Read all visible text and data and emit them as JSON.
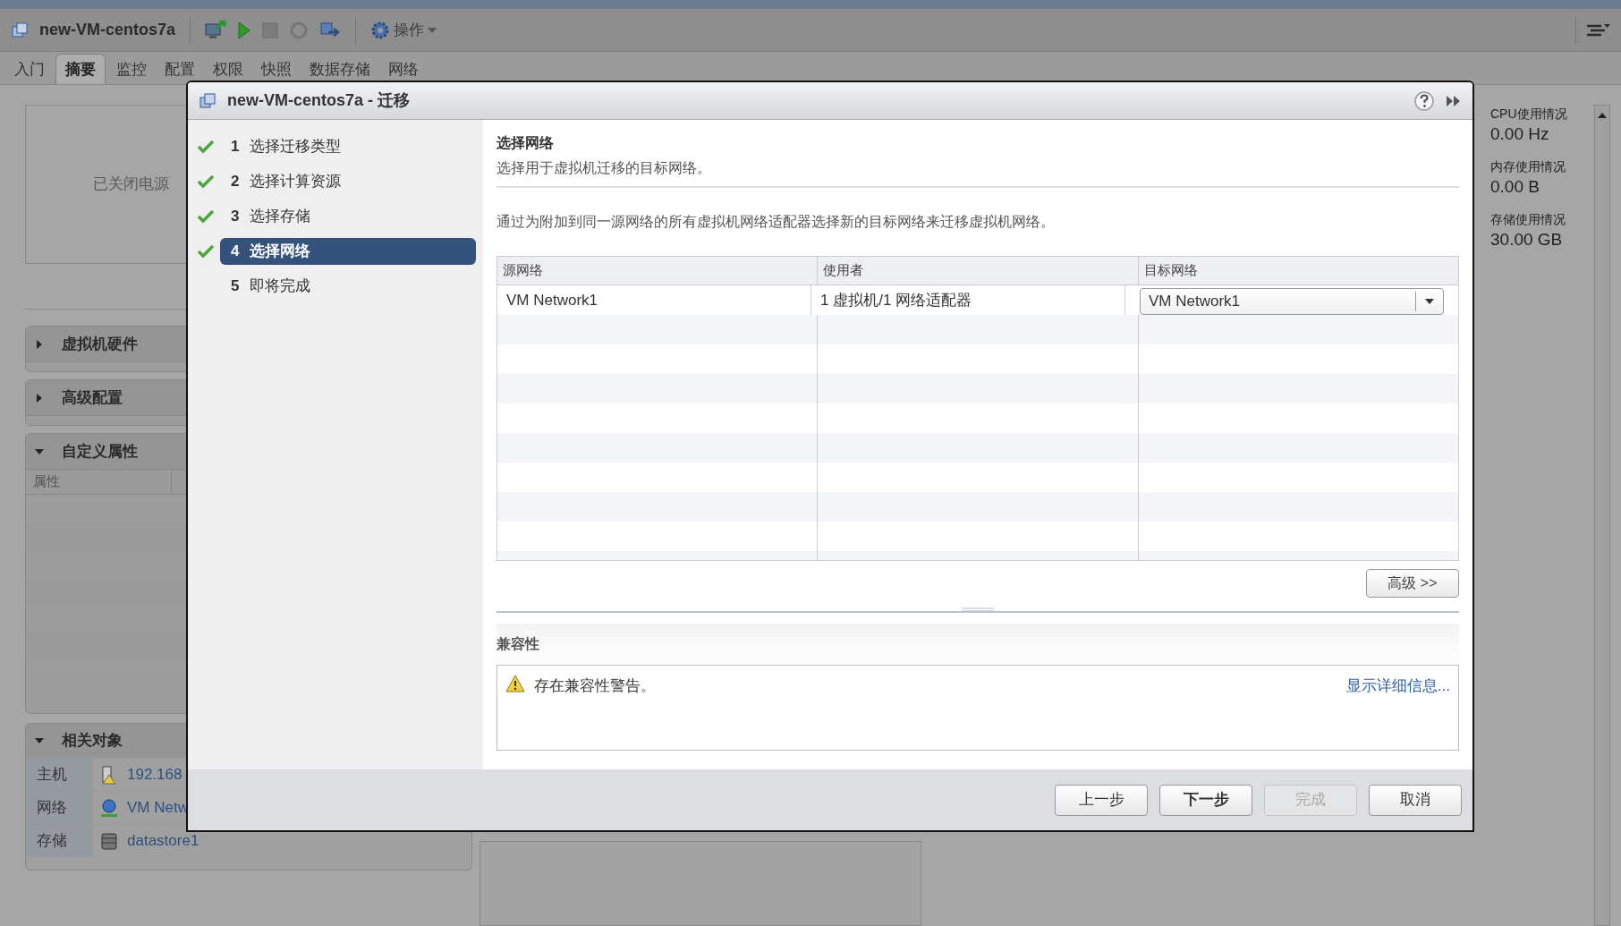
{
  "toolbar": {
    "title": "new-VM-centos7a",
    "actions_label": "操作"
  },
  "tabs": [
    {
      "label": "入门",
      "selected": false
    },
    {
      "label": "摘要",
      "selected": true
    },
    {
      "label": "监控",
      "selected": false
    },
    {
      "label": "配置",
      "selected": false
    },
    {
      "label": "权限",
      "selected": false
    },
    {
      "label": "快照",
      "selected": false
    },
    {
      "label": "数据存储",
      "selected": false
    },
    {
      "label": "网络",
      "selected": false
    }
  ],
  "power_state": "已关闭电源",
  "sections": [
    {
      "title": "虚拟机硬件",
      "expanded": false
    },
    {
      "title": "高级配置",
      "expanded": false
    },
    {
      "title": "自定义属性",
      "expanded": true
    }
  ],
  "custom_attributes": {
    "columns": [
      "属性"
    ]
  },
  "related_objects": {
    "title": "相关对象",
    "expanded": true,
    "rows": [
      {
        "label": "主机",
        "kind": "host",
        "value": "192.168"
      },
      {
        "label": "网络",
        "kind": "network",
        "value": "VM Netw"
      },
      {
        "label": "存储",
        "kind": "datastore",
        "value": "datastore1"
      }
    ]
  },
  "stats": [
    {
      "label": "CPU使用情况",
      "value": "0.00 Hz"
    },
    {
      "label": "内存使用情况",
      "value": "0.00 B"
    },
    {
      "label": "存储使用情况",
      "value": "30.00 GB"
    }
  ],
  "dialog": {
    "title": "new-VM-centos7a - 迁移",
    "steps": [
      {
        "number": "1",
        "label": "选择迁移类型",
        "done": true,
        "selected": false
      },
      {
        "number": "2",
        "label": "选择计算资源",
        "done": true,
        "selected": false
      },
      {
        "number": "3",
        "label": "选择存储",
        "done": true,
        "selected": false
      },
      {
        "number": "4",
        "label": "选择网络",
        "done": true,
        "selected": true
      },
      {
        "number": "5",
        "label": "即将完成",
        "done": false,
        "selected": false
      }
    ],
    "heading": "选择网络",
    "subheading": "选择用于虚拟机迁移的目标网络。",
    "description": "通过为附加到同一源网络的所有虚拟机网络适配器选择新的目标网络来迁移虚拟机网络。",
    "table": {
      "columns": [
        "源网络",
        "使用者",
        "目标网络"
      ],
      "rows": [
        {
          "source": "VM Network1",
          "used_by": "1 虚拟机/1 网络适配器",
          "target": "VM Network1"
        }
      ]
    },
    "advanced_button": "高级 >>",
    "compatibility": {
      "title": "兼容性",
      "message": "存在兼容性警告。",
      "link": "显示详细信息..."
    },
    "buttons": [
      {
        "label": "上一步",
        "kind": "normal",
        "disabled": false
      },
      {
        "label": "下一步",
        "kind": "primary",
        "disabled": false
      },
      {
        "label": "完成",
        "kind": "normal",
        "disabled": true
      },
      {
        "label": "取消",
        "kind": "normal",
        "disabled": false
      }
    ]
  }
}
